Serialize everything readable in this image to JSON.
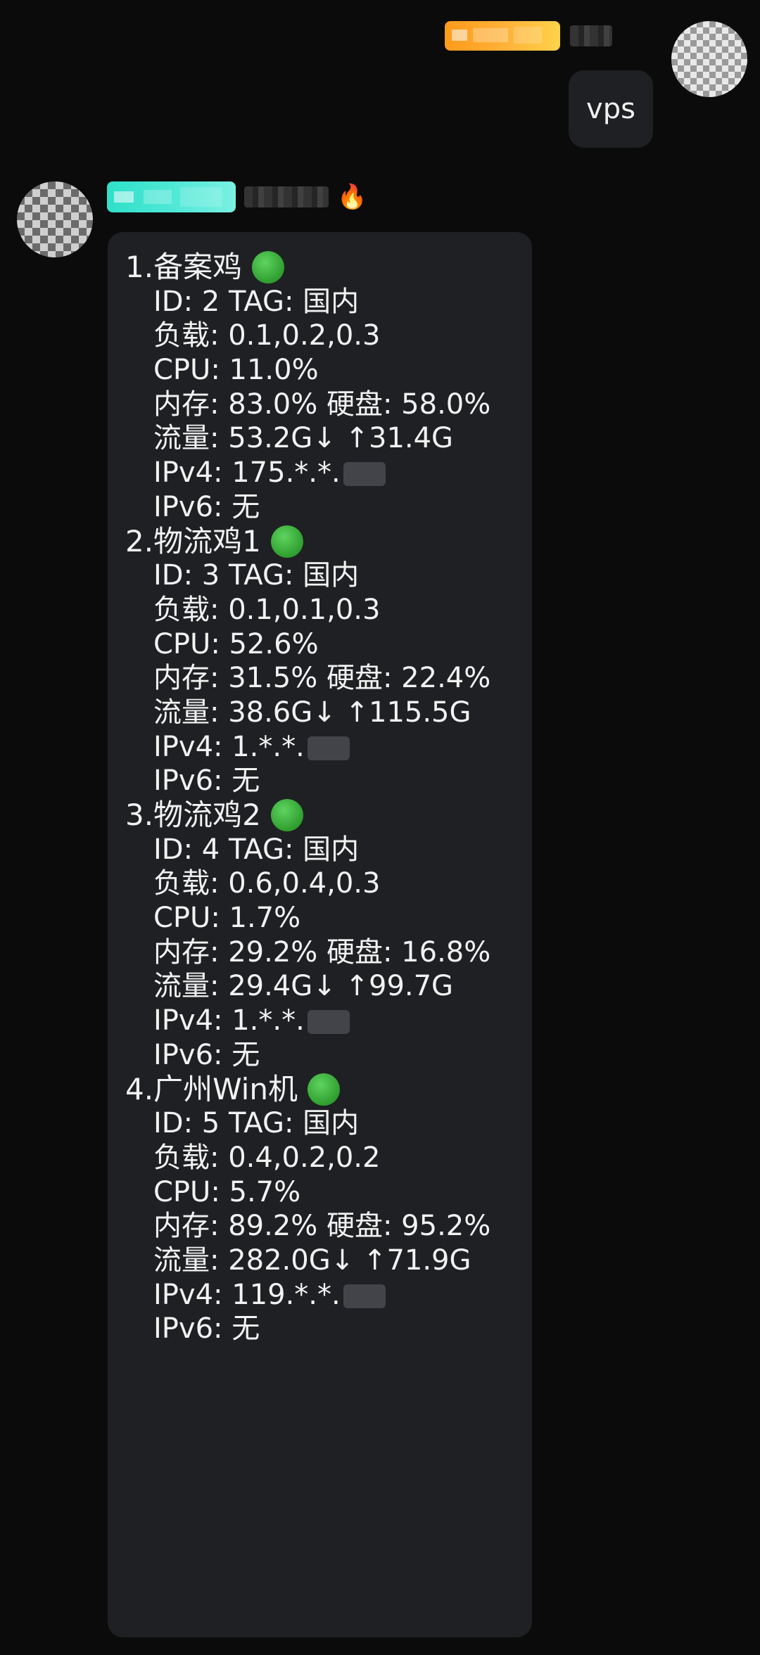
{
  "outgoing": {
    "message": "vps"
  },
  "incoming": {
    "servers": [
      {
        "title": "1.备案鸡",
        "lines": [
          "ID: 2 TAG: 国内",
          "负载: 0.1,0.2,0.3",
          "CPU: 11.0%",
          "内存: 83.0% 硬盘: 58.0%",
          "流量: 53.2G↓ ↑31.4G",
          "IPv4: 175.*.*.",
          "IPv6: 无"
        ]
      },
      {
        "title": "2.物流鸡1",
        "lines": [
          "ID: 3 TAG: 国内",
          "负载: 0.1,0.1,0.3",
          "CPU: 52.6%",
          "内存: 31.5% 硬盘: 22.4%",
          "流量: 38.6G↓ ↑115.5G",
          "IPv4: 1.*.*.",
          "IPv6: 无"
        ]
      },
      {
        "title": "3.物流鸡2",
        "lines": [
          "ID: 4 TAG: 国内",
          "负载: 0.6,0.4,0.3",
          "CPU: 1.7%",
          "内存: 29.2% 硬盘: 16.8%",
          "流量: 29.4G↓ ↑99.7G",
          "IPv4: 1.*.*.",
          "IPv6: 无"
        ]
      },
      {
        "title": "4.广州Win机",
        "lines": [
          "ID: 5 TAG: 国内",
          "负载: 0.4,0.2,0.2",
          "CPU: 5.7%",
          "内存: 89.2% 硬盘: 95.2%",
          "流量: 282.0G↓ ↑71.9G",
          "IPv4: 119.*.*.",
          "IPv6: 无"
        ]
      }
    ]
  },
  "icons": {
    "status": "green-circle-icon",
    "fire": "fire-icon"
  },
  "colors": {
    "background": "#0b0b0c",
    "bubble": "#1f2023",
    "online": "#3cb043",
    "badge_orange": "#ffb33a",
    "badge_teal": "#4ee8d6"
  }
}
